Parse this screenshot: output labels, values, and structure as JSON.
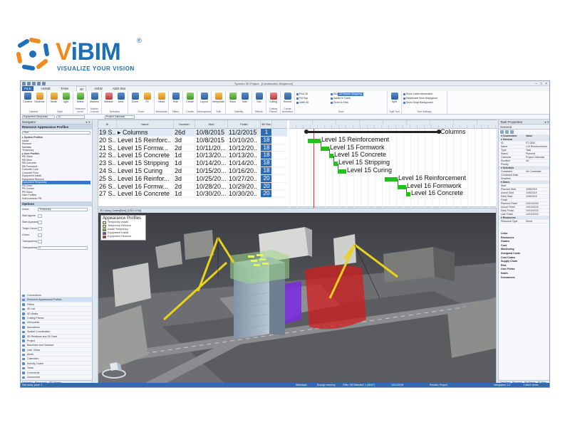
{
  "brand": {
    "name_v": "V",
    "name_rest": "iBIM",
    "registered": "®",
    "tagline": "VISUALIZE YOUR VISION",
    "color_primary": "#1d6fb8",
    "color_accent": "#f08a1c"
  },
  "window": {
    "title": "Synchro 4D Project - [Construction Sequence]",
    "controls": [
      "–",
      "□",
      "×"
    ]
  },
  "ribbon_tabs": [
    "FILE",
    "HOME",
    "TASK",
    "3D",
    "VIEW",
    "ADD-INS"
  ],
  "ribbon_groups": [
    {
      "name": "Camera",
      "buttons": [
        "Camera",
        "Observer"
      ]
    },
    {
      "name": "Style",
      "buttons": [
        "Mode",
        "Light"
      ]
    },
    {
      "name": "Selection Level",
      "buttons": [
        "Select"
      ]
    },
    {
      "name": "Marker Colours",
      "buttons": [
        "Markers"
      ]
    },
    {
      "name": "Selection",
      "buttons": [
        "Window",
        "Area"
      ]
    },
    {
      "name": "Zoom",
      "buttons": [
        "Zoom",
        "Fit"
      ]
    },
    {
      "name": "Viewpoints",
      "buttons": [
        "Views"
      ]
    },
    {
      "name": "Filters",
      "buttons": [
        "Hide"
      ]
    },
    {
      "name": "Create",
      "buttons": [
        "Create"
      ]
    },
    {
      "name": "Workspaces",
      "buttons": [
        "Layout"
      ]
    },
    {
      "name": "Edit",
      "buttons": [
        "Interpolate"
      ]
    },
    {
      "name": "Visibility",
      "buttons": [
        "Show",
        "Hide"
      ]
    },
    {
      "name": "Effects",
      "buttons": [
        "Sun"
      ]
    },
    {
      "name": "Cutting Planes",
      "buttons": [
        "Cutting"
      ]
    },
    {
      "name": "Create Animation",
      "buttons": [
        "Record"
      ]
    },
    {
      "name": "Tools",
      "buttons": []
    },
    {
      "name": "Split Tool",
      "buttons": [
        "Split"
      ]
    },
    {
      "name": "Tool Settings",
      "buttons": []
    }
  ],
  "ribbon_small": {
    "left": [
      "Find 3D",
      "Fill Gap",
      "Unfill 3D"
    ],
    "mid": [
      "Show in Gantt",
      "Isolate in Gantt",
      "Zoom to Task"
    ],
    "chip": "3D Resize Snapping",
    "right": [
      "Show Label Intersection",
      "Dashboard Work Backgroun",
      "Show Snap Background"
    ]
  },
  "selectors": {
    "left": "Equipment Temporary",
    "mid": "10",
    "right": "Project Calendar"
  },
  "navigator": {
    "title": "Navigator",
    "subtitle": "Resource Appearance Profiles",
    "search_placeholder": "Find",
    "tree": [
      {
        "text": "System Profiles",
        "bold": true
      },
      {
        "text": "Install"
      },
      {
        "text": "Remove"
      },
      {
        "text": "Maintain"
      },
      {
        "text": "Temporary"
      },
      {
        "text": "User Profiles",
        "bold": true
      },
      {
        "text": "RB Glass"
      },
      {
        "text": "RB Steel"
      },
      {
        "text": "RB Concrete"
      },
      {
        "text": "RB Formwork"
      },
      {
        "text": "Concrete Core"
      },
      {
        "text": "Concrete Floor"
      },
      {
        "text": "Equipment Install"
      },
      {
        "text": "Equipment Remove"
      },
      {
        "text": "Equipment Temporary",
        "selected": true
      },
      {
        "text": "PB Color"
      },
      {
        "text": "PB Curtain"
      },
      {
        "text": "PB Glass"
      },
      {
        "text": "User Profiles"
      },
      {
        "text": "Subcontractor PB"
      }
    ],
    "settings_title": "Options",
    "controls": [
      {
        "label": "Active",
        "value": "Temporary"
      },
      {
        "label": "Start appear"
      },
      {
        "label": "Start Appearance"
      },
      {
        "label": "Target Colour"
      },
      {
        "label": "Colour"
      },
      {
        "label": "Transparency"
      },
      {
        "label": "Transparency",
        "value": "0"
      }
    ],
    "items": [
      "Connections",
      "Resource Appearance Profiles",
      "Filters",
      "3D List",
      "3D Walks",
      "Cutting Planes",
      "Viewpoints",
      "Animations",
      "Spatial Coordination",
      "3D Relations and 3D Data",
      "Project",
      "Baselines and Variance",
      "User Views",
      "Alerts",
      "Calendars",
      "Activity Codes",
      "Tasks",
      "Comments",
      "Documents",
      "Layers",
      "Risks",
      "Task Markers",
      "Resource Statuses"
    ],
    "selected_item": 1,
    "tabs": [
      "Navigator",
      "Resources",
      "3D Objects"
    ]
  },
  "gantt": {
    "headers": [
      "ID",
      "Name",
      "Duration",
      "Start",
      "Finish",
      "3D Res"
    ],
    "rows": [
      {
        "id": "19 S..",
        "name": "Columns",
        "duration": "26d",
        "start": "10/8/2015",
        "finish": "11/2/2015",
        "pct": "1",
        "summary": true
      },
      {
        "id": "20 S..",
        "name": "Level 15 Reinforc..",
        "duration": "3d",
        "start": "10/8/2015",
        "finish": "10/10/20..",
        "pct": "18"
      },
      {
        "id": "21 S..",
        "name": "Level 15 Formw...",
        "duration": "2d",
        "start": "10/11/20...",
        "finish": "10/12/20..",
        "pct": "18"
      },
      {
        "id": "22 S..",
        "name": "Level 15 Concrete",
        "duration": "1d",
        "start": "10/13/20...",
        "finish": "10/13/20..",
        "pct": "18"
      },
      {
        "id": "23 S..",
        "name": "Level 15 Stripping",
        "duration": "1d",
        "start": "10/14/20...",
        "finish": "10/14/20..",
        "pct": "18"
      },
      {
        "id": "24 S..",
        "name": "Level 15 Curing",
        "duration": "2d",
        "start": "10/15/20...",
        "finish": "10/16/20..",
        "pct": "18"
      },
      {
        "id": "25 S..",
        "name": "Level 16 Reinfor...",
        "duration": "3d",
        "start": "10/25/20...",
        "finish": "10/27/20..",
        "pct": "20"
      },
      {
        "id": "26 S..",
        "name": "Level 16 Formw...",
        "duration": "2d",
        "start": "10/28/20...",
        "finish": "10/29/20..",
        "pct": "20"
      },
      {
        "id": "27 S..",
        "name": "Level 16 Concrete",
        "duration": "1d",
        "start": "10/30/20...",
        "finish": "10/30/20..",
        "pct": "20"
      }
    ],
    "bars": [
      {
        "label": "Columns",
        "summary": true
      },
      {
        "label": "Level 15 Reinforcement"
      },
      {
        "label": "Level 15 Formwork"
      },
      {
        "label": "Level 15 Concrete"
      },
      {
        "label": "Level 15 Stripping"
      },
      {
        "label": "Level 15 Curing"
      },
      {
        "label": "Level 16 Reinforcement"
      },
      {
        "label": "Level 16 Formwork"
      },
      {
        "label": "Level 16 Concrete"
      }
    ],
    "bar_color": "#22c21b",
    "selected_color": "#2f6bb3",
    "tabs": [
      "Gantt 3D",
      "Lookahead",
      "Tables"
    ]
  },
  "view3d": {
    "title": "3D Using Dates[Bed] [1557x794]",
    "legend_title": "Appearance Profiles",
    "legend": [
      {
        "label": "Temporary Install",
        "color": "#d9ef9a"
      },
      {
        "label": "Temporary Remove",
        "color": "#f2d58a"
      },
      {
        "label": "Install Temporary",
        "color": "#67d34b"
      },
      {
        "label": "Equipment Install",
        "color": "#9b2bd6"
      },
      {
        "label": "Equipment Remove",
        "color": "#d02b2b"
      }
    ]
  },
  "properties": {
    "title": "Task Properties",
    "section": "General",
    "rows": [
      {
        "k": "Customizes",
        "v": "Value",
        "cat": true
      },
      {
        "k": "General",
        "v": "",
        "cat": true
      },
      {
        "k": "ID",
        "v": "ST-0050"
      },
      {
        "k": "Name",
        "v": "L15 Reinforcement"
      },
      {
        "k": "Type",
        "v": "Task"
      },
      {
        "k": "Status",
        "v": "Planned"
      },
      {
        "k": "Calendar",
        "v": "Project Calendar"
      },
      {
        "k": "Duration",
        "v": "3d"
      },
      {
        "k": "Priority",
        "v": ""
      },
      {
        "k": "Schedule",
        "v": "",
        "cat": true
      },
      {
        "k": "Constraint",
        "v": "No Constraint"
      },
      {
        "k": "Constraint Date",
        "v": ""
      },
      {
        "k": "Deadline",
        "v": ""
      },
      {
        "k": "Dates",
        "v": "",
        "cat": true
      },
      {
        "k": "Start",
        "v": ""
      },
      {
        "k": "Planned Start",
        "v": "10/8/2015"
      },
      {
        "k": "Actual Start",
        "v": "10/8/2015"
      },
      {
        "k": "Early Start",
        "v": "10/8/2015"
      },
      {
        "k": "Finish",
        "v": ""
      },
      {
        "k": "Planned Finish",
        "v": "10/10/2015"
      },
      {
        "k": "Actual Finish",
        "v": "10/10/2015"
      },
      {
        "k": "Early Finish",
        "v": "10/10/2015"
      },
      {
        "k": "Late Finish",
        "v": "10/10/2015"
      },
      {
        "k": "Resources",
        "v": "",
        "cat": true
      },
      {
        "k": "Resource Type",
        "v": "Direct"
      }
    ],
    "list": [
      "Links",
      "Resources",
      "Guides",
      "Cost",
      "Monitoring",
      "Assigned Costs",
      "Cost Codes",
      "Supply Chain",
      "Risk",
      "User Fields",
      "Notes",
      "Documents"
    ],
    "tabs": [
      "Task Prop",
      "Resource",
      "3D Objects",
      "3D Filter"
    ]
  },
  "status": {
    "left": "Not ready, pane: 1",
    "mid1": "Workdays",
    "mid2": "Enough memory",
    "mid3": "Filter: Off  Selected: 1 (40/47)",
    "mid4": "10/11/2015",
    "mid5": "Presets: Project",
    "right1": "Navigation: 1.0",
    "right2": "Linked Views"
  }
}
